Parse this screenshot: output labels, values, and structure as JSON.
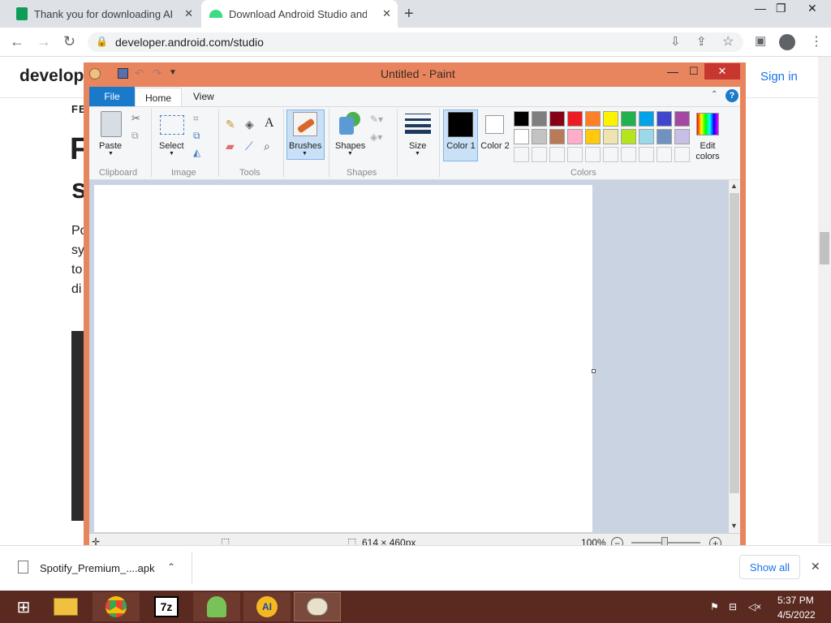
{
  "browser": {
    "tabs": [
      {
        "title": "Thank you for downloading APK"
      },
      {
        "title": "Download Android Studio and SDK"
      }
    ],
    "url": "developer.android.com/studio"
  },
  "page": {
    "logo": "develope",
    "signin": "Sign in",
    "fragments": [
      "FE",
      "F",
      "s",
      "Po",
      "sy",
      "to",
      "di"
    ]
  },
  "paint": {
    "title": "Untitled - Paint",
    "tabs": {
      "file": "File",
      "home": "Home",
      "view": "View"
    },
    "groups": {
      "clipboard": "Clipboard",
      "image": "Image",
      "tools": "Tools",
      "shapes": "Shapes",
      "colors": "Colors"
    },
    "buttons": {
      "paste": "Paste",
      "select": "Select",
      "brushes": "Brushes",
      "shapes": "Shapes",
      "size": "Size",
      "color1": "Color 1",
      "color2": "Color 2",
      "edit_colors": "Edit colors"
    },
    "palette_row1": [
      "#000000",
      "#7f7f7f",
      "#880015",
      "#ed1c24",
      "#ff7f27",
      "#fff200",
      "#22b14c",
      "#00a2e8",
      "#3f48cc",
      "#a349a4"
    ],
    "palette_row2": [
      "#ffffff",
      "#c3c3c3",
      "#b97a57",
      "#ffaec9",
      "#ffc90e",
      "#efe4b0",
      "#b5e61d",
      "#99d9ea",
      "#7092be",
      "#c8bfe7"
    ],
    "color1": "#000000",
    "color2": "#ffffff",
    "dimensions": "614 × 460px",
    "zoom": "100%"
  },
  "downloads": {
    "file": "Spotify_Premium_....apk",
    "show_all": "Show all"
  },
  "taskbar": {
    "time": "5:37 PM",
    "date": "4/5/2022"
  }
}
